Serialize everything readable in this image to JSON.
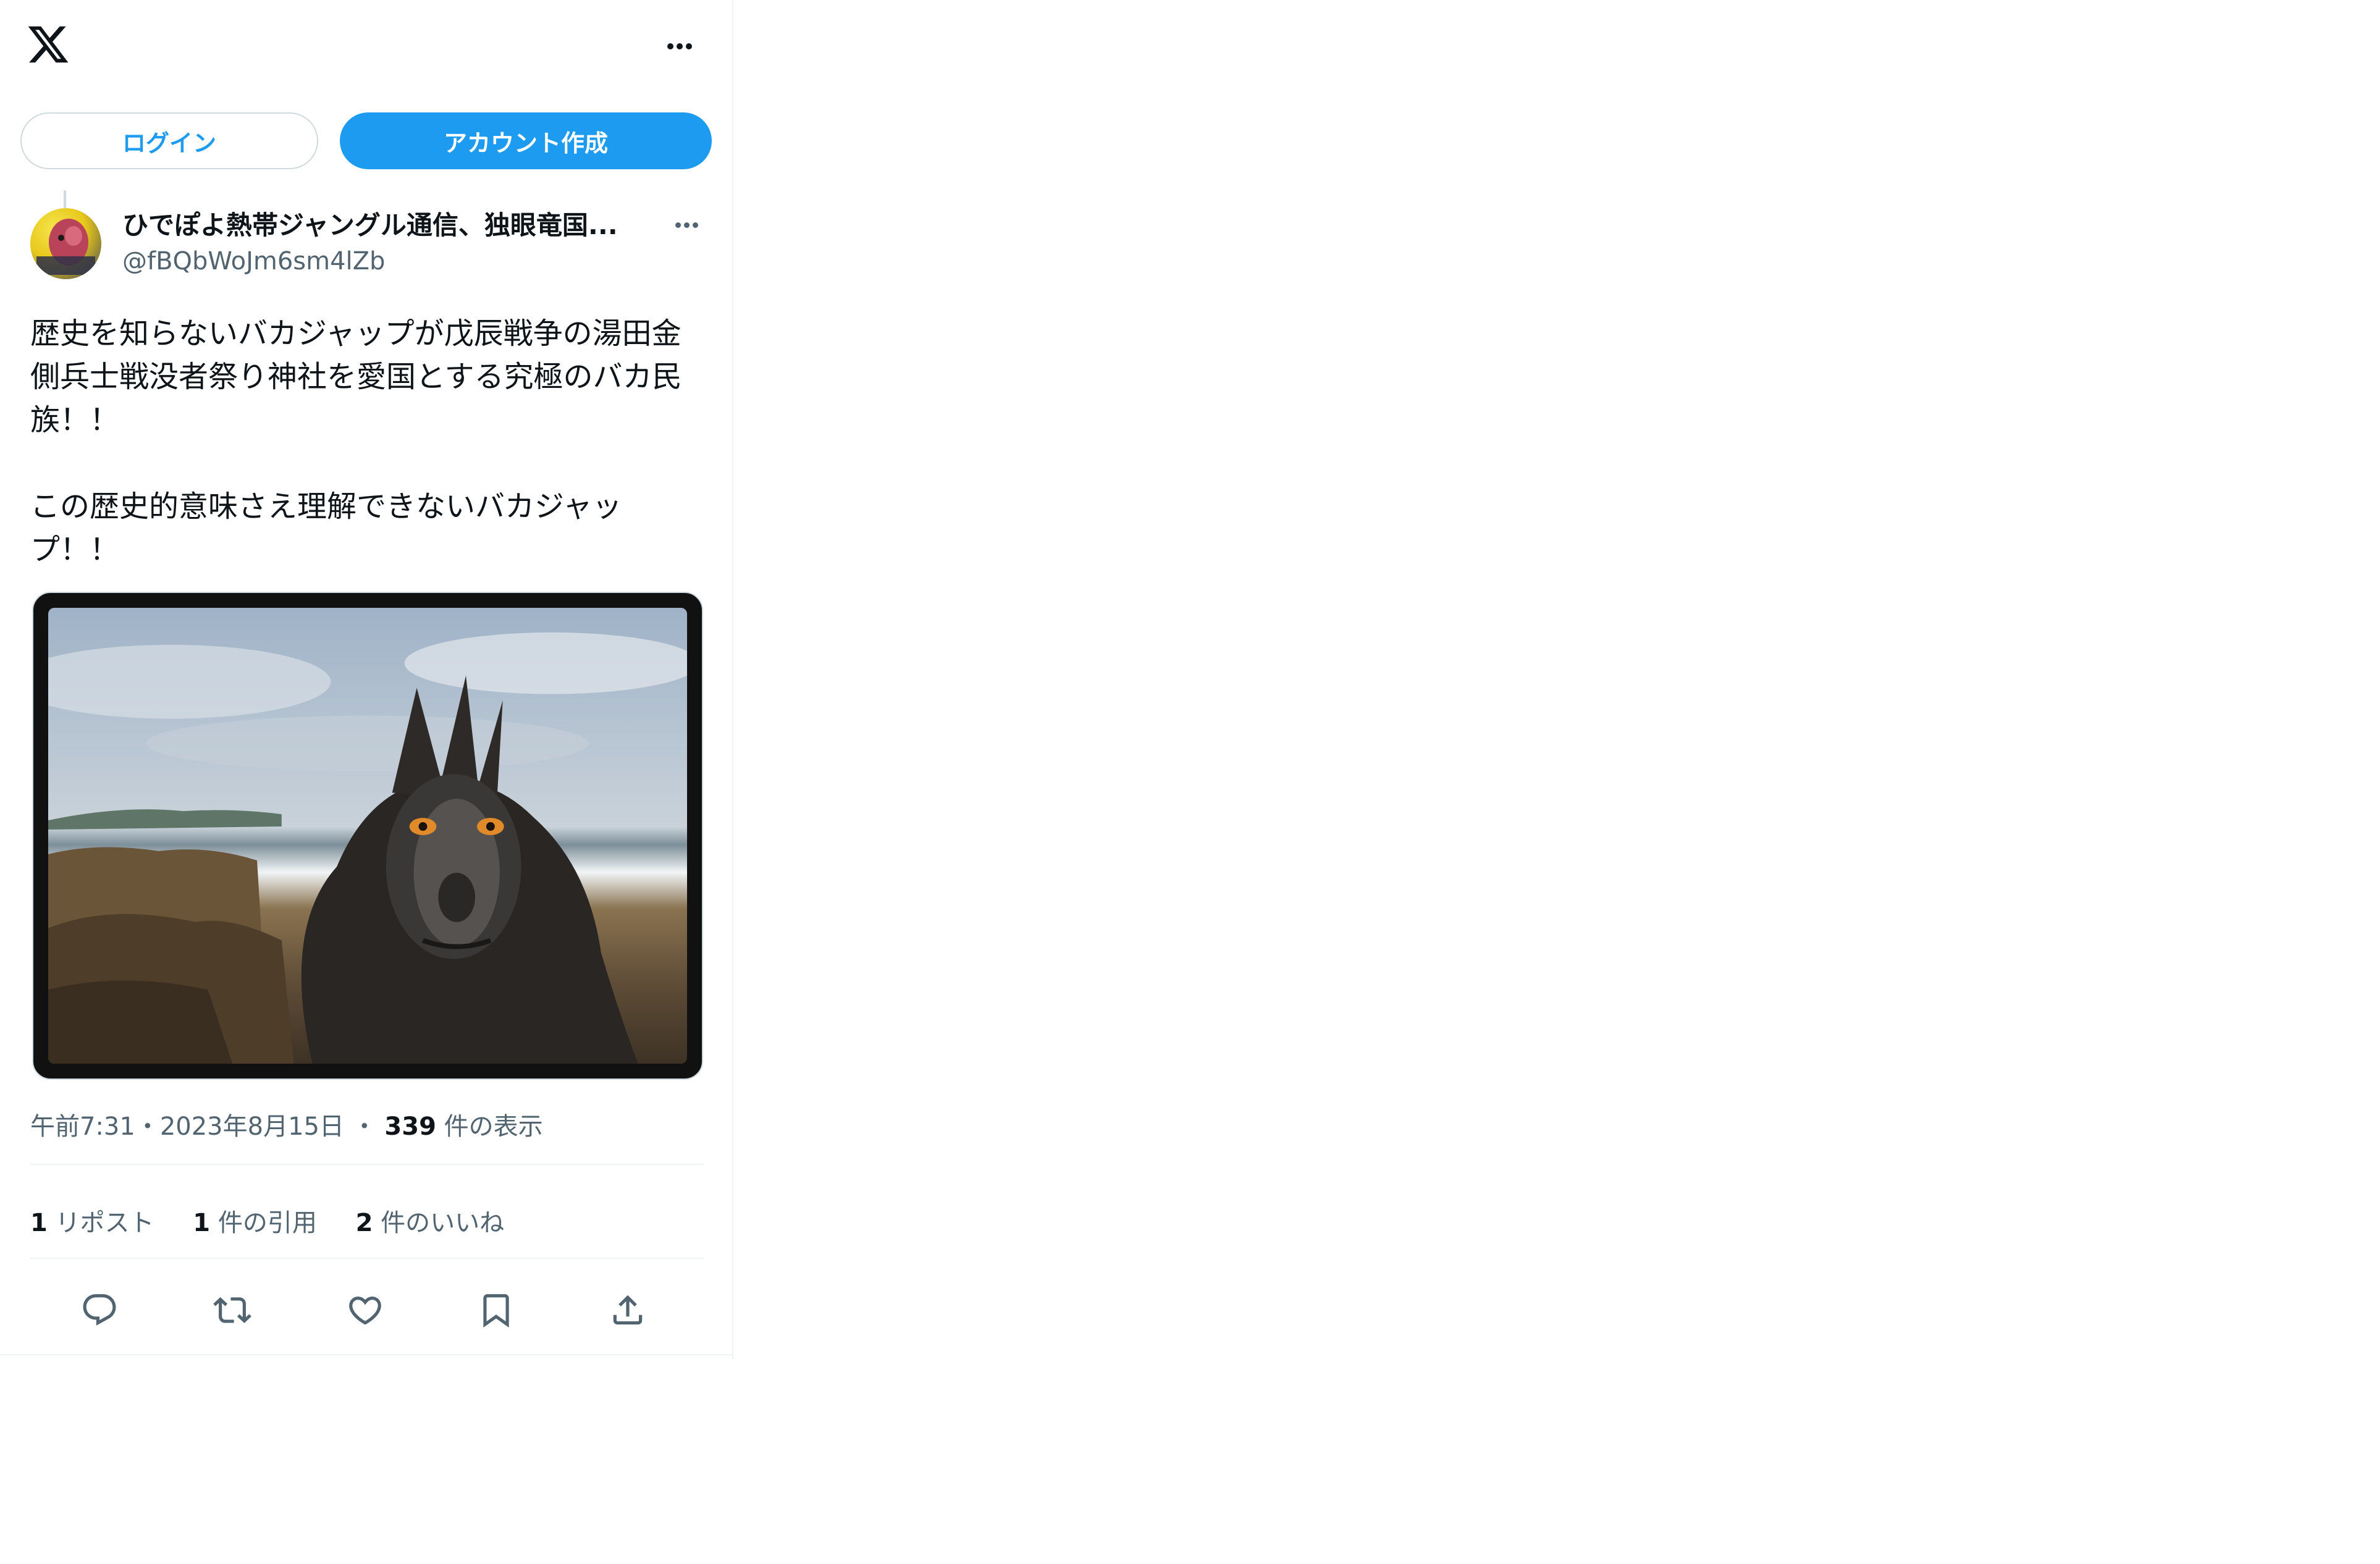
{
  "header": {
    "logo_icon": "x-logo-icon",
    "more_icon": "more-horizontal-icon"
  },
  "auth": {
    "login_label": "ログイン",
    "signup_label": "アカウント作成"
  },
  "author": {
    "name": "ひでぽよ熱帯ジャングル通信、独眼竜国...",
    "handle": "@fBQbWoJm6sm4lZb",
    "avatar_icon": "avatar"
  },
  "tweet": {
    "text": "歴史を知らないバカジャップが戊辰戦争の湯田金\n側兵士戦没者祭り神社を愛国とする究極のバカ民\n族！！\n\nこの歴史的意味さえ理解できないバカジャッ\nプ！！",
    "time": "午前7:31",
    "sep1": "・",
    "date": "2023年8月15日",
    "sep2": "・",
    "views_count": "339",
    "views_label": "件の表示"
  },
  "stats": {
    "reposts_count": "1",
    "reposts_label": "リポスト",
    "quotes_count": "1",
    "quotes_label": "件の引用",
    "likes_count": "2",
    "likes_label": "件のいいね"
  },
  "actions": [
    "reply-icon",
    "repost-icon",
    "like-icon",
    "bookmark-icon",
    "share-icon"
  ],
  "colors": {
    "accent": "#1d9bf0",
    "text": "#0f1419",
    "secondary": "#536471",
    "border": "#eff3f4"
  }
}
